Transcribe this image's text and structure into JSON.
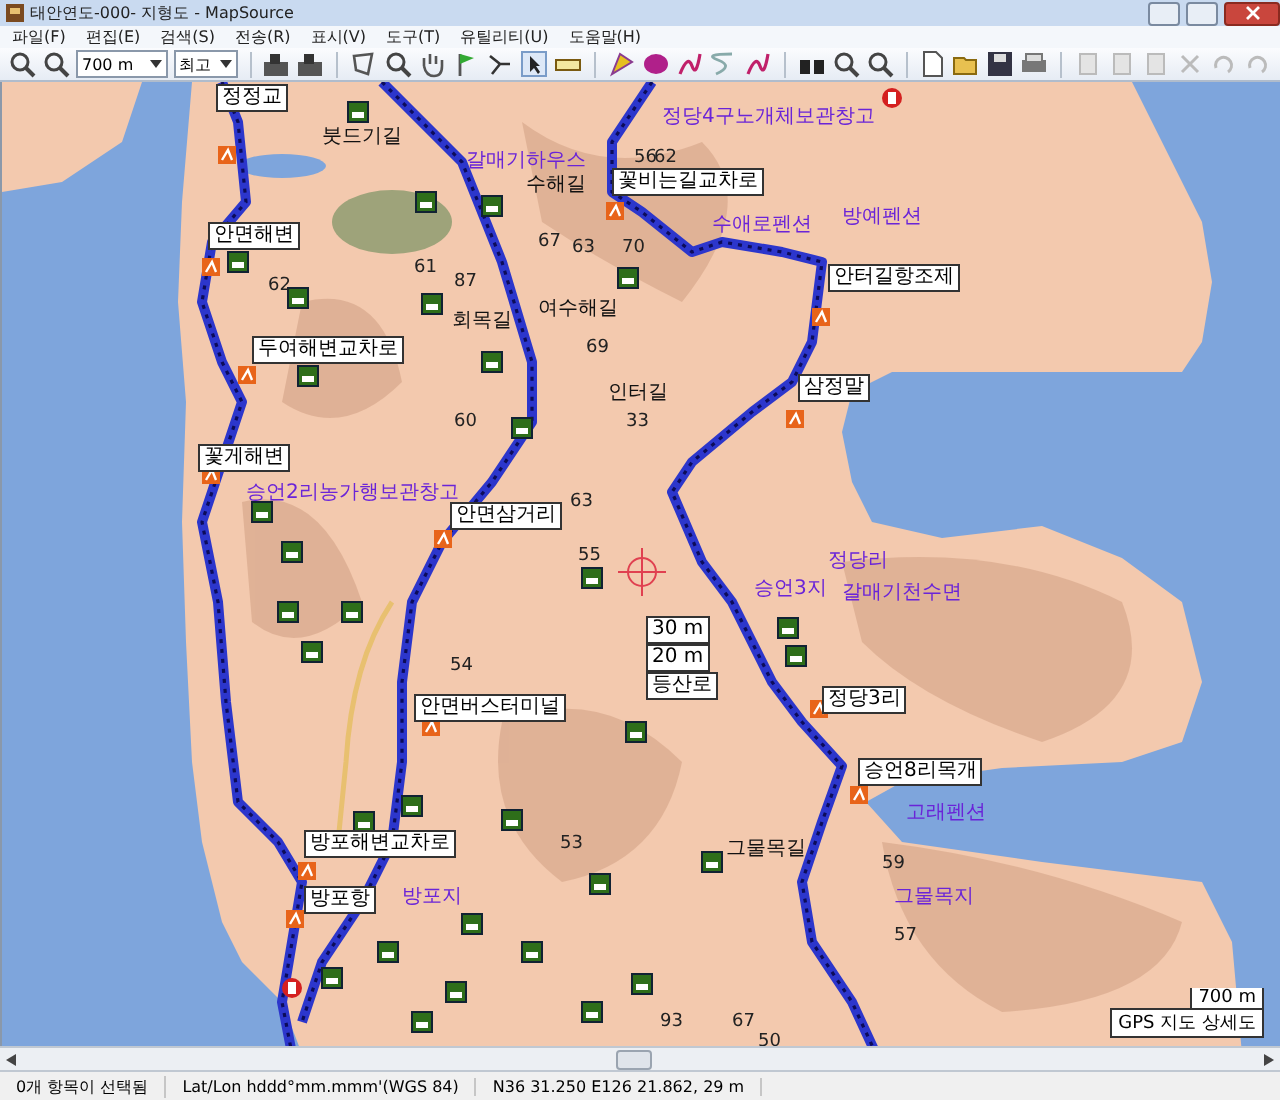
{
  "window": {
    "title": "태안연도-000- 지형도 - MapSource"
  },
  "menu": [
    "파일(F)",
    "편집(E)",
    "검색(S)",
    "전송(R)",
    "표시(V)",
    "도구(T)",
    "유틸리티(U)",
    "도움말(H)"
  ],
  "toolbar": {
    "scale": "700 m",
    "detail": "최고"
  },
  "map": {
    "boxed_labels": [
      "정정교",
      "꽃비는길교차로",
      "안면해변",
      "안터길항조제",
      "두여해변교차로",
      "삼정말",
      "꽃게해변",
      "안면삼거리",
      "30 m",
      "20 m",
      "등산로",
      "안면버스터미널",
      "정당3리",
      "승언8리목개",
      "방포해변교차로",
      "방포항"
    ],
    "road_labels": [
      "붓드기길",
      "수해길",
      "여수해길",
      "회목길",
      "인터길",
      "그물목길"
    ],
    "poi_labels": [
      "갈매기하우스",
      "정당4구노개체보관창고",
      "수애로펜션",
      "방예펜션",
      "승언2리농가행보관창고",
      "승언3지",
      "정당리",
      "갈매기천수면",
      "방포지",
      "고래펜션",
      "그물목지"
    ],
    "elevations": [
      "56",
      "62",
      "67",
      "63",
      "70",
      "61",
      "62",
      "87",
      "69",
      "60",
      "33",
      "63",
      "55",
      "54",
      "53",
      "59",
      "57",
      "93",
      "67",
      "50"
    ],
    "scale_box": "700 m",
    "map_detail": "GPS 지도 상세도"
  },
  "status_bar": [
    "0개 항목이 선택됨",
    "Lat/Lon hddd°mm.mmm'(WGS 84)",
    "N36 31.250 E126 21.862, 29 m"
  ]
}
